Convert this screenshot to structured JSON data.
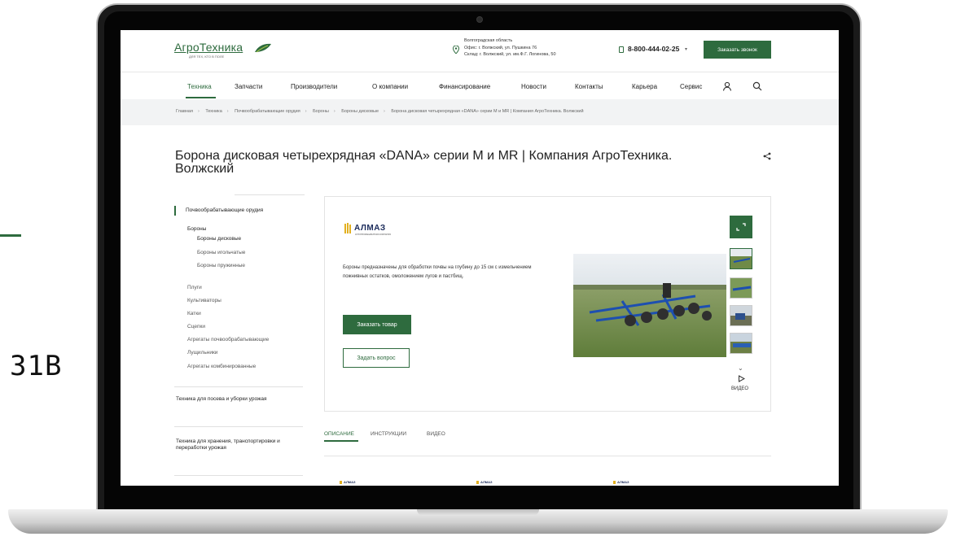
{
  "side": {
    "label": "31B",
    "accent": "#2e6b3e"
  },
  "header": {
    "logo_main": "АгроТехника",
    "logo_sub": "ДЛЯ ТЕХ, КТО В ПОЛЕ",
    "address": {
      "region": "Волгоградская область",
      "office": "Офис: г. Волжский, ул. Пушкина 76",
      "warehouse": "Склад: г. Волжский, ул. им.Ф.Г. Логинова, 50"
    },
    "phone": "8-800-444-02-25",
    "call_button": "Заказать звонок"
  },
  "nav": {
    "items": [
      "Техника",
      "Запчасти",
      "Производители",
      "О компании",
      "Финансирование",
      "Новости",
      "Контакты",
      "Карьера",
      "Сервис"
    ],
    "active": "Техника"
  },
  "breadcrumb": [
    "Главная",
    "Техника",
    "Почвообрабатывающие орудия",
    "Бороны",
    "Бороны дисковые",
    "Борона дисковая четырехрядная «DANA» серии M и MR | Компания АгроТехника. Волжский"
  ],
  "page_title": "Борона дисковая четырехрядная «DANA» серии M и MR | Компания АгроТехника. Волжский",
  "sidebar": {
    "head": "Почвообрабатывающие орудия",
    "group": "Бороны",
    "subitems": [
      "Бороны дисковые",
      "Бороны игольчатые",
      "Бороны пружинные"
    ],
    "items": [
      "Плуги",
      "Культиваторы",
      "Катки",
      "Сцепки",
      "Агрегаты почвообрабатывающие",
      "Лущильники",
      "Агрегаты комбинированные"
    ],
    "section2": "Техника для посева и уборки урожая",
    "section3": "Техника для хранения, транспортировки и переработки урожая"
  },
  "product": {
    "brand": "АЛМАЗ",
    "brand_sub": "АГРОПРОМЫШЛЕННАЯ КОМПАНИЯ",
    "description": "Бороны предназначены для обработки почвы на глубину до 15 см с измельчением пожнивных остатков, омоложением лугов и пастбищ.",
    "order_button": "Заказать товар",
    "ask_button": "Задать вопрос",
    "video_label": "ВИДЕО",
    "expand_icon": "expand-icon"
  },
  "tabs": {
    "items": [
      "ОПИСАНИЕ",
      "ИНСТРУКЦИИ",
      "ВИДЕО"
    ],
    "active": "ОПИСАНИЕ"
  },
  "mini_brand": "АЛМАЗ"
}
